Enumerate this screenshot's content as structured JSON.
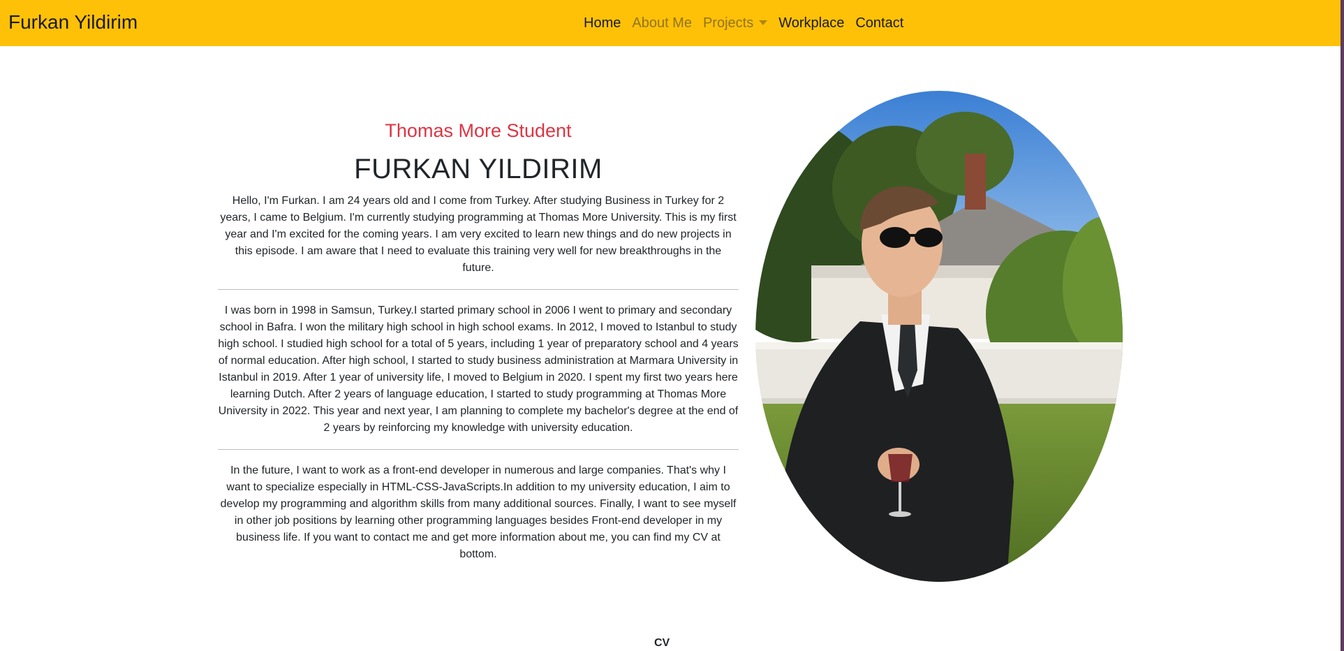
{
  "navbar": {
    "brand": "Furkan Yildirim",
    "links": [
      {
        "label": "Home"
      },
      {
        "label": "About Me"
      },
      {
        "label": "Projects"
      },
      {
        "label": "Workplace"
      },
      {
        "label": "Contact"
      }
    ],
    "background_color": "#ffc107"
  },
  "main": {
    "subtitle": "Thomas More Student",
    "title": "FURKAN YILDIRIM",
    "paragraphs": [
      "Hello, I'm Furkan. I am 24 years old and I come from Turkey. After studying Business in Turkey for 2 years, I came to Belgium. I'm currently studying programming at Thomas More University. This is my first year and I'm excited for the coming years. I am very excited to learn new things and do new projects in this episode. I am aware that I need to evaluate this training very well for new breakthroughs in the future.",
      "I was born in 1998 in Samsun, Turkey.I started primary school in 2006 I went to primary and secondary school in Bafra. I won the military high school in high school exams. In 2012, I moved to Istanbul to study high school. I studied high school for a total of 5 years, including 1 year of preparatory school and 4 years of normal education. After high school, I started to study business administration at Marmara University in Istanbul in 2019. After 1 year of university life, I moved to Belgium in 2020. I spent my first two years here learning Dutch. After 2 years of language education, I started to study programming at Thomas More University in 2022. This year and next year, I am planning to complete my bachelor's degree at the end of 2 years by reinforcing my knowledge with university education.",
      "In the future, I want to work as a front-end developer in numerous and large companies. That's why I want to specialize especially in HTML-CSS-JavaScripts.In addition to my university education, I aim to develop my programming and algorithm skills from many additional sources. Finally, I want to see myself in other job positions by learning other programming languages besides Front-end developer in my business life. If you want to contact me and get more information about me, you can find my CV at bottom."
    ],
    "subtitle_color": "#dc3545"
  },
  "footer": {
    "cv_label": "CV"
  }
}
